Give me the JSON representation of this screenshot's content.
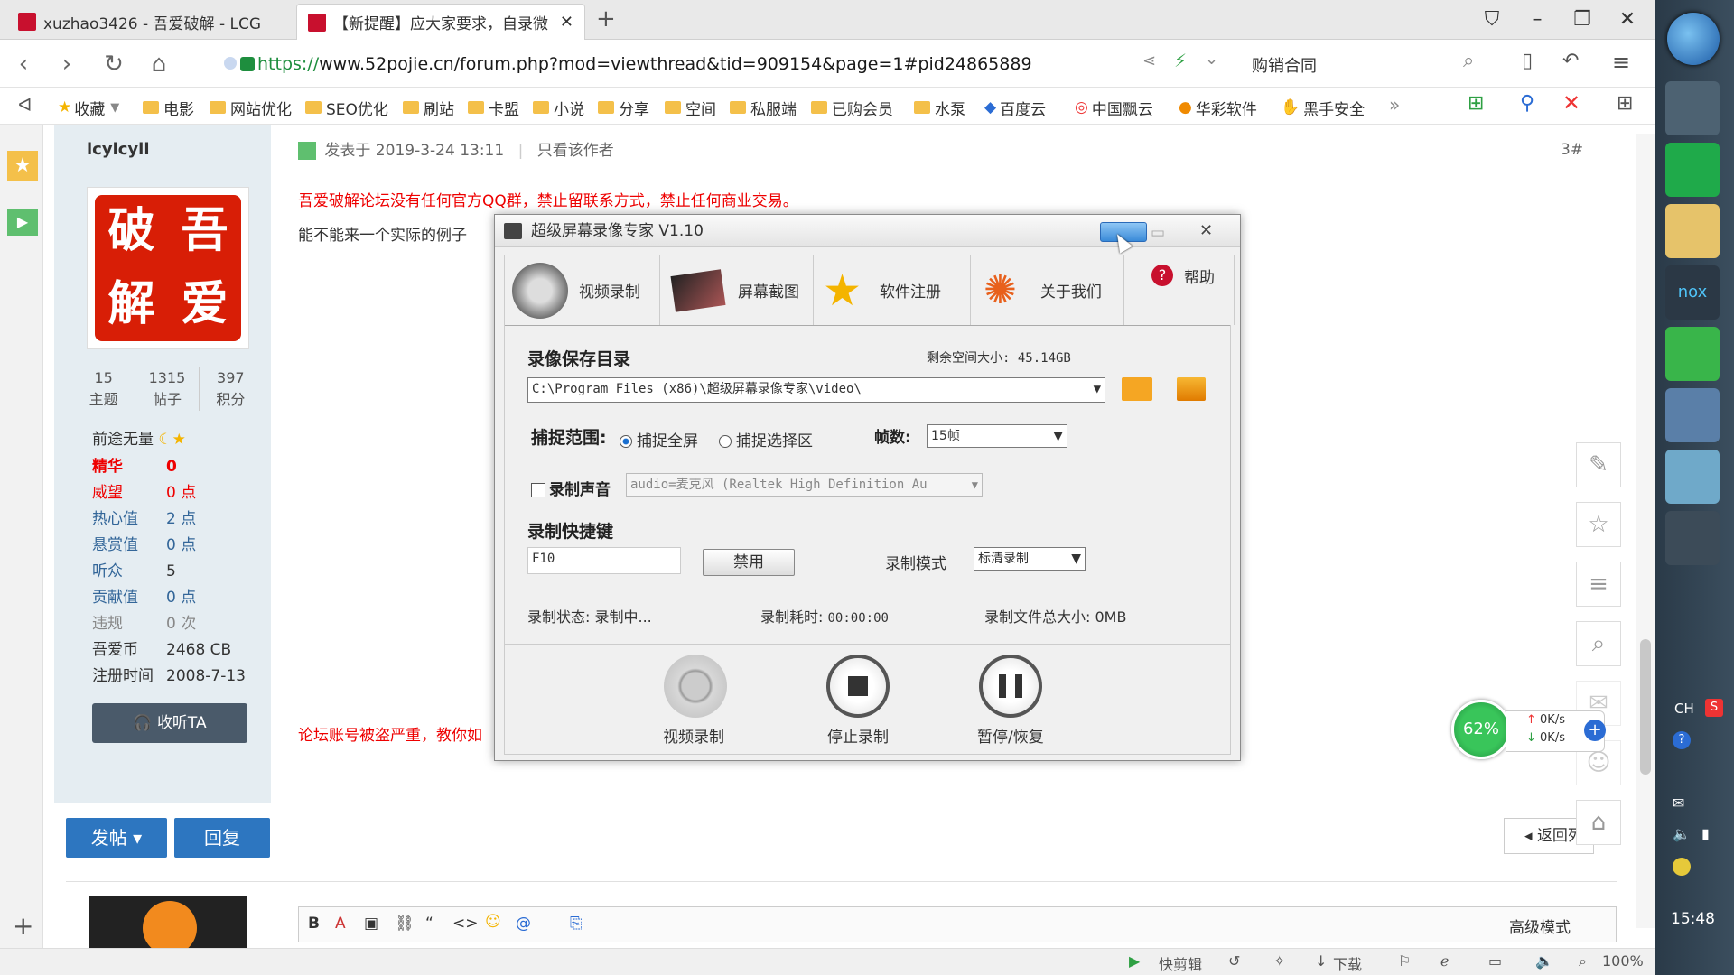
{
  "browser": {
    "tabs": [
      {
        "title": "xuzhao3426 - 吾爱破解 - LCG"
      },
      {
        "title": "【新提醒】应大家要求，自录微"
      }
    ],
    "url_prefix": "https://",
    "url_rest": "www.52pojie.cn/forum.php?mod=viewthread&tid=909154&page=1#pid24865889",
    "address_right_label": "购销合同",
    "bookmarks": [
      "收藏",
      "电影",
      "网站优化",
      "SEO优化",
      "刷站",
      "卡盟",
      "小说",
      "分享",
      "空间",
      "私服端",
      "已购会员",
      "水泵",
      "百度云",
      "中国飘云",
      "华彩软件",
      "黑手安全"
    ]
  },
  "post": {
    "author": "lcylcyll",
    "avatar_chars": [
      "破",
      "吾",
      "解",
      "爱"
    ],
    "stats": [
      {
        "value": "15",
        "label": "主题"
      },
      {
        "value": "1315",
        "label": "帖子"
      },
      {
        "value": "397",
        "label": "积分"
      }
    ],
    "rank": "前途无量",
    "info": [
      {
        "key": "精华",
        "value": "0",
        "style": "red"
      },
      {
        "key": "威望",
        "value": "0 点",
        "style": "blue"
      },
      {
        "key": "热心值",
        "value": "2 点",
        "style": "blue"
      },
      {
        "key": "悬赏值",
        "value": "0 点",
        "style": "blue"
      },
      {
        "key": "听众",
        "value": "5",
        "style": "blue"
      },
      {
        "key": "贡献值",
        "value": "0 点",
        "style": "blue"
      },
      {
        "key": "违规",
        "value": "0 次",
        "style": "plain"
      },
      {
        "key": "吾爱币",
        "value": "2468 CB",
        "style": "plain"
      },
      {
        "key": "注册时间",
        "value": "2008-7-13",
        "style": "plain"
      }
    ],
    "listen_btn": "收听TA",
    "meta": "发表于 2019-3-24 13:11",
    "only_author": "只看该作者",
    "floor": "3#",
    "notice": "吾爱破解论坛没有任何官方QQ群，禁止留联系方式，禁止任何商业交易。",
    "body": "能不能来一个实际的例子",
    "notice2": "论坛账号被盗严重，教你如",
    "post_btn": "发帖",
    "reply_btn": "回复",
    "back_btn": "返回列",
    "advanced_mode": "高级模式"
  },
  "dialog": {
    "title": "超级屏幕录像专家 V1.10",
    "tabs": [
      "视频录制",
      "屏幕截图",
      "软件注册",
      "关于我们",
      "帮助"
    ],
    "save_dir_label": "录像保存目录",
    "free_space": "剩余空间大小: 45.14GB",
    "save_dir_value": "C:\\Program Files (x86)\\超级屏幕录像专家\\video\\",
    "capture_range_label": "捕捉范围:",
    "radio_fullscreen": "捕捉全屏",
    "radio_region": "捕捉选择区",
    "fps_label": "帧数:",
    "fps_value": "15帧",
    "record_audio_label": "录制声音",
    "audio_device": "audio=麦克风 (Realtek High Definition Au",
    "hotkey_label": "录制快捷键",
    "hotkey_value": "F10",
    "disable_btn": "禁用",
    "mode_label": "录制模式",
    "mode_value": "标清录制",
    "status_label": "录制状态: 录制中...",
    "elapsed_label": "录制耗时:",
    "elapsed_value": "00:00:00",
    "filesize_label": "录制文件总大小: 0MB",
    "btn_record": "视频录制",
    "btn_stop": "停止录制",
    "btn_pause": "暂停/恢复"
  },
  "netmon": {
    "percent": "62%",
    "up": "0K/s",
    "down": "0K/s"
  },
  "statusbar": {
    "quick_edit": "快剪辑",
    "download": "下载",
    "zoom": "100%"
  },
  "taskbar": {
    "ime": "CH",
    "time": "15:48"
  },
  "colors": {
    "accent": "#2d76c0",
    "red": "#e00000",
    "brand": "#c8102e"
  }
}
